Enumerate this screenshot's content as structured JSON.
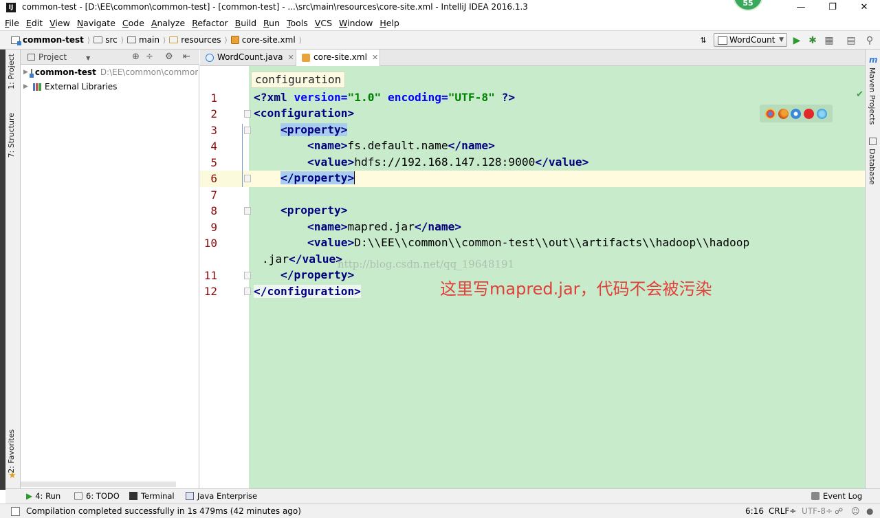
{
  "window": {
    "title": "common-test - [D:\\EE\\common\\common-test] - [common-test] - ...\\src\\main\\resources\\core-site.xml - IntelliJ IDEA 2016.1.3",
    "badge_count": "55",
    "app_icon_label": "IJ"
  },
  "menu": [
    "File",
    "Edit",
    "View",
    "Navigate",
    "Code",
    "Analyze",
    "Refactor",
    "Build",
    "Run",
    "Tools",
    "VCS",
    "Window",
    "Help"
  ],
  "breadcrumb": {
    "project": "common-test",
    "src": "src",
    "main": "main",
    "resources": "resources",
    "file": "core-site.xml"
  },
  "toolbar": {
    "run_config": "WordCount"
  },
  "left_strip": {
    "project_tab": "1: Project",
    "structure_tab": "7: Structure",
    "favorites_tab": "2: Favorites"
  },
  "project_panel": {
    "header_label": "Project",
    "root_name": "common-test",
    "root_path": "D:\\EE\\common\\common-test",
    "external_libraries": "External Libraries"
  },
  "tabs": [
    {
      "label": "WordCount.java",
      "active": false
    },
    {
      "label": "core-site.xml",
      "active": true
    }
  ],
  "editor": {
    "breadcrumb_popup": "configuration",
    "line_numbers": [
      "1",
      "2",
      "3",
      "4",
      "5",
      "6",
      "7",
      "8",
      "9",
      "10",
      "11",
      "12"
    ],
    "lines": {
      "l1_decl_open": "<?",
      "l1_xml": "xml",
      "l1_version_attr": "version",
      "l1_version_val": "\"1.0\"",
      "l1_encoding_attr": "encoding",
      "l1_encoding_val": "\"UTF-8\"",
      "l1_decl_close": "?>",
      "l2": "<configuration>",
      "l3": "<property>",
      "l4_open": "<name>",
      "l4_text": "fs.default.name",
      "l4_close": "</name>",
      "l5_open": "<value>",
      "l5_text": "hdfs://192.168.147.128:9000",
      "l5_close": "</value>",
      "l6": "</property>",
      "l8": "<property>",
      "l9_open": "<name>",
      "l9_text": "mapred.jar",
      "l9_close": "</name>",
      "l10_open": "<value>",
      "l10_text": "D:\\\\EE\\\\common\\\\common-test\\\\out\\\\artifacts\\\\hadoop\\\\hadoop",
      "l10_wrap_text": ".jar",
      "l10_close": "</value>",
      "l11": "</property>",
      "l12": "</configuration>"
    },
    "watermark": "http://blog.csdn.net/qq_19648191",
    "annotation": "这里写mapred.jar，代码不会被污染"
  },
  "right_strip": {
    "maven": "Maven Projects",
    "database": "Database"
  },
  "bottom_tools": {
    "run": "4: Run",
    "todo": "6: TODO",
    "terminal": "Terminal",
    "java_enterprise": "Java Enterprise",
    "event_log": "Event Log"
  },
  "status": {
    "message": "Compilation completed successfully in 1s 479ms (42 minutes ago)",
    "position": "6:16",
    "line_sep": "CRLF÷",
    "encoding": "UTF-8÷"
  },
  "colors": {
    "code_bg": "#c8ebcc",
    "tag": "#000080",
    "attr": "#0000ff",
    "string": "#008000",
    "annotation": "#e0403a"
  }
}
